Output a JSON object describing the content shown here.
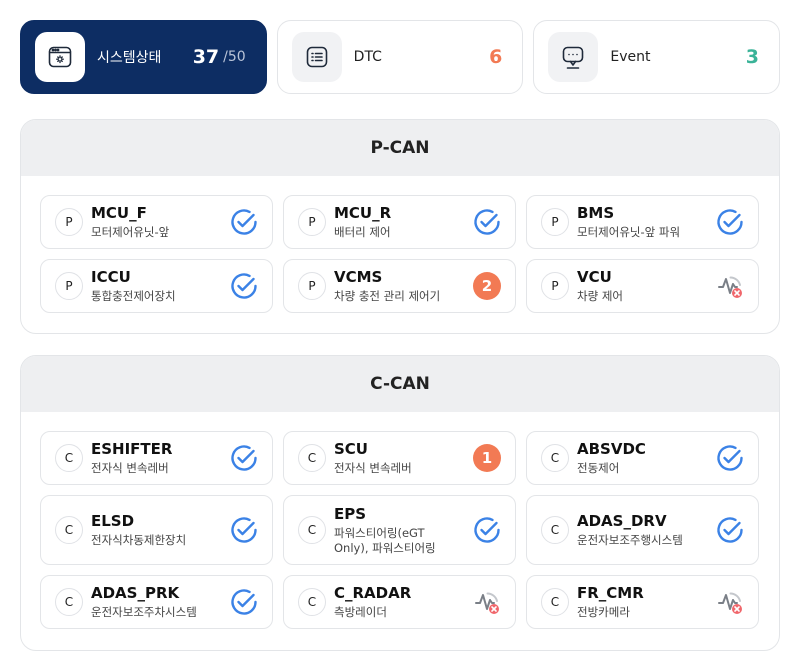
{
  "summary": [
    {
      "label": "시스템상태",
      "value": "37",
      "total": "/50",
      "icon": "system-window-icon",
      "active": true
    },
    {
      "label": "DTC",
      "value": "6",
      "icon": "dtc-list-icon",
      "color": "#f27a54"
    },
    {
      "label": "Event",
      "value": "3",
      "icon": "event-chat-icon",
      "color": "#3ab398"
    }
  ],
  "colors": {
    "navy": "#0d2d63",
    "ok_blue": "#3b82e6",
    "warn_orange": "#f27a54",
    "event_green": "#3ab398",
    "disconnected_red": "#f0666b"
  },
  "groups": [
    {
      "title": "P-CAN",
      "items": [
        {
          "badge": "P",
          "name": "MCU_F",
          "desc": "모터제어유닛-앞",
          "status": "ok",
          "status_icon": "check-circle-icon"
        },
        {
          "badge": "P",
          "name": "MCU_R",
          "desc": "배터리 제어",
          "status": "ok",
          "status_icon": "check-circle-icon"
        },
        {
          "badge": "P",
          "name": "BMS",
          "desc": "모터제어유닛-앞 파워",
          "status": "ok",
          "status_icon": "check-circle-icon"
        },
        {
          "badge": "P",
          "name": "ICCU",
          "desc": "통합충전제어장치",
          "status": "ok",
          "status_icon": "check-circle-icon"
        },
        {
          "badge": "P",
          "name": "VCMS",
          "desc": "차량 충전 관리 제어기",
          "status": "count",
          "count": "2"
        },
        {
          "badge": "P",
          "name": "VCU",
          "desc": "차량 제어",
          "status": "offline",
          "status_icon": "signal-error-icon"
        }
      ]
    },
    {
      "title": "C-CAN",
      "items": [
        {
          "badge": "C",
          "name": "ESHIFTER",
          "desc": "전자식 변속레버",
          "status": "ok",
          "status_icon": "check-circle-icon"
        },
        {
          "badge": "C",
          "name": "SCU",
          "desc": "전자식 변속레버",
          "status": "count",
          "count": "1"
        },
        {
          "badge": "C",
          "name": "ABSVDC",
          "desc": "전동제어",
          "status": "ok",
          "status_icon": "check-circle-icon"
        },
        {
          "badge": "C",
          "name": "ELSD",
          "desc": "전자식차동제한장치",
          "status": "ok",
          "status_icon": "check-circle-icon"
        },
        {
          "badge": "C",
          "name": "EPS",
          "desc": "파워스티어링(eGT Only), 파워스티어링",
          "status": "ok",
          "status_icon": "check-circle-icon"
        },
        {
          "badge": "C",
          "name": "ADAS_DRV",
          "desc": "운전자보조주행시스템",
          "status": "ok",
          "status_icon": "check-circle-icon"
        },
        {
          "badge": "C",
          "name": "ADAS_PRK",
          "desc": "운전자보조주차시스템",
          "status": "ok",
          "status_icon": "check-circle-icon"
        },
        {
          "badge": "C",
          "name": "C_RADAR",
          "desc": "측방레이더",
          "status": "offline",
          "status_icon": "signal-error-icon"
        },
        {
          "badge": "C",
          "name": "FR_CMR",
          "desc": "전방카메라",
          "status": "offline",
          "status_icon": "signal-error-icon"
        }
      ]
    }
  ]
}
